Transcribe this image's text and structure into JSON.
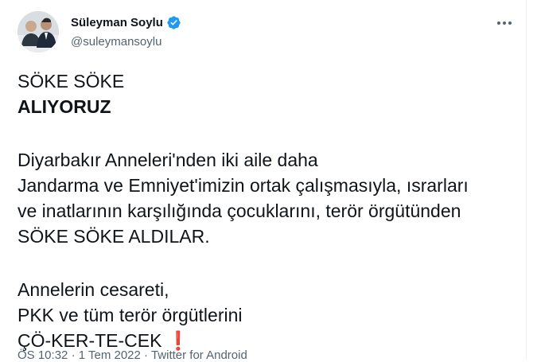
{
  "author": {
    "display_name": "Süleyman Soylu",
    "handle": "@suleymansoylu"
  },
  "icons": {
    "verified": "verified-badge-icon",
    "more": "more-options-icon",
    "exclamation": "red-exclamation-emoji"
  },
  "tweet": {
    "lines": [
      "SÖKE SÖKE",
      "ALIYORUZ",
      "Diyarbakır Anneleri'nden iki aile daha",
      "Jandarma ve Emniyet'imizin ortak çalışmasıyla, ısrarları",
      "ve inatlarının karşılığında çocuklarını, terör örgütünden",
      "SÖKE SÖKE ALDILAR.",
      "Annelerin cesareti,",
      "PKK ve tüm terör örgütlerini",
      "ÇÖ-KER-TE-CEK"
    ],
    "emoji": "❗"
  },
  "meta": {
    "time": "ÖS 10:32",
    "separator": "·",
    "date": "1 Tem 2022",
    "source": "Twitter for Android"
  },
  "colors": {
    "text": "#0f1419",
    "secondary": "#536471",
    "verified": "#1d9bf0",
    "emoji": "#dd2e44"
  }
}
